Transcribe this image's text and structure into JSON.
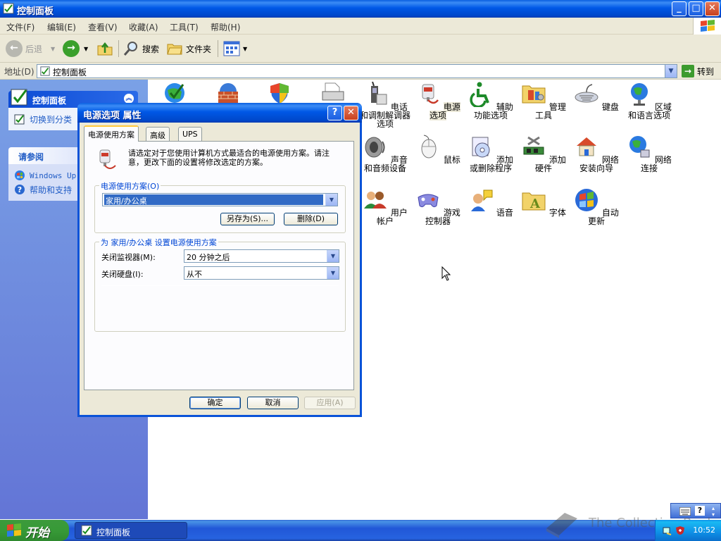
{
  "window": {
    "title": "控制面板",
    "buttons": {
      "minimize": "_",
      "maximize": "□",
      "close": "✕"
    }
  },
  "menu": [
    "文件(F)",
    "编辑(E)",
    "查看(V)",
    "收藏(A)",
    "工具(T)",
    "帮助(H)"
  ],
  "toolbar": {
    "back": "后退",
    "search": "搜索",
    "folders": "文件夹"
  },
  "address": {
    "label": "地址(D)",
    "value": "控制面板",
    "go": "转到"
  },
  "taskpane": {
    "cp": {
      "title": "控制面板",
      "link": "切换到分类"
    },
    "seealso": {
      "title": "请参阅",
      "links": [
        "Windows Up",
        "帮助和支持"
      ]
    }
  },
  "items": [
    {
      "label": "电话和调制解调器选项",
      "icon": "phone-modem-icon"
    },
    {
      "label": "电源选项",
      "icon": "power-options-icon"
    },
    {
      "label": "辅助功能选项",
      "icon": "accessibility-icon"
    },
    {
      "label": "管理工具",
      "icon": "admin-tools-icon"
    },
    {
      "label": "键盘",
      "icon": "keyboard-icon"
    },
    {
      "label": "区域和语言选项",
      "icon": "region-language-icon"
    },
    {
      "label": "声音和音频设备",
      "icon": "sound-icon"
    },
    {
      "label": "鼠标",
      "icon": "mouse-icon"
    },
    {
      "label": "添加或删除程序",
      "icon": "add-remove-icon"
    },
    {
      "label": "添加硬件",
      "icon": "add-hardware-icon"
    },
    {
      "label": "网络安装向导",
      "icon": "network-wizard-icon"
    },
    {
      "label": "网络连接",
      "icon": "network-connections-icon"
    },
    {
      "label": "用户帐户",
      "icon": "user-accounts-icon"
    },
    {
      "label": "游戏控制器",
      "icon": "game-controller-icon"
    },
    {
      "label": "语音",
      "icon": "speech-icon"
    },
    {
      "label": "字体",
      "icon": "fonts-icon"
    },
    {
      "label": "自动更新",
      "icon": "auto-update-icon"
    }
  ],
  "dialog": {
    "title": "电源选项 属性",
    "help": "?",
    "tabs": [
      "电源使用方案",
      "高级",
      "UPS"
    ],
    "description": "请选定对于您使用计算机方式最适合的电源使用方案。请注意，更改下面的设置将修改选定的方案。",
    "scheme_group": "电源使用方案(O)",
    "scheme_value": "家用/办公桌",
    "save_as": "另存为(S)...",
    "delete": "删除(D)",
    "settings_group": "为 家用/办公桌 设置电源使用方案",
    "monitor_label": "关闭监视器(M):",
    "monitor_value": "20 分钟之后",
    "disk_label": "关闭硬盘(I):",
    "disk_value": "从不",
    "ok": "确定",
    "cancel": "取消",
    "apply": "应用(A)"
  },
  "taskbar": {
    "start": "开始",
    "task": "控制面板",
    "clock": "10:52"
  },
  "watermark": "The Collection Book",
  "colors": {
    "xp_blue": "#0054e3",
    "pane_blue": "#6c8cd9",
    "start_green": "#3c9a3c"
  }
}
